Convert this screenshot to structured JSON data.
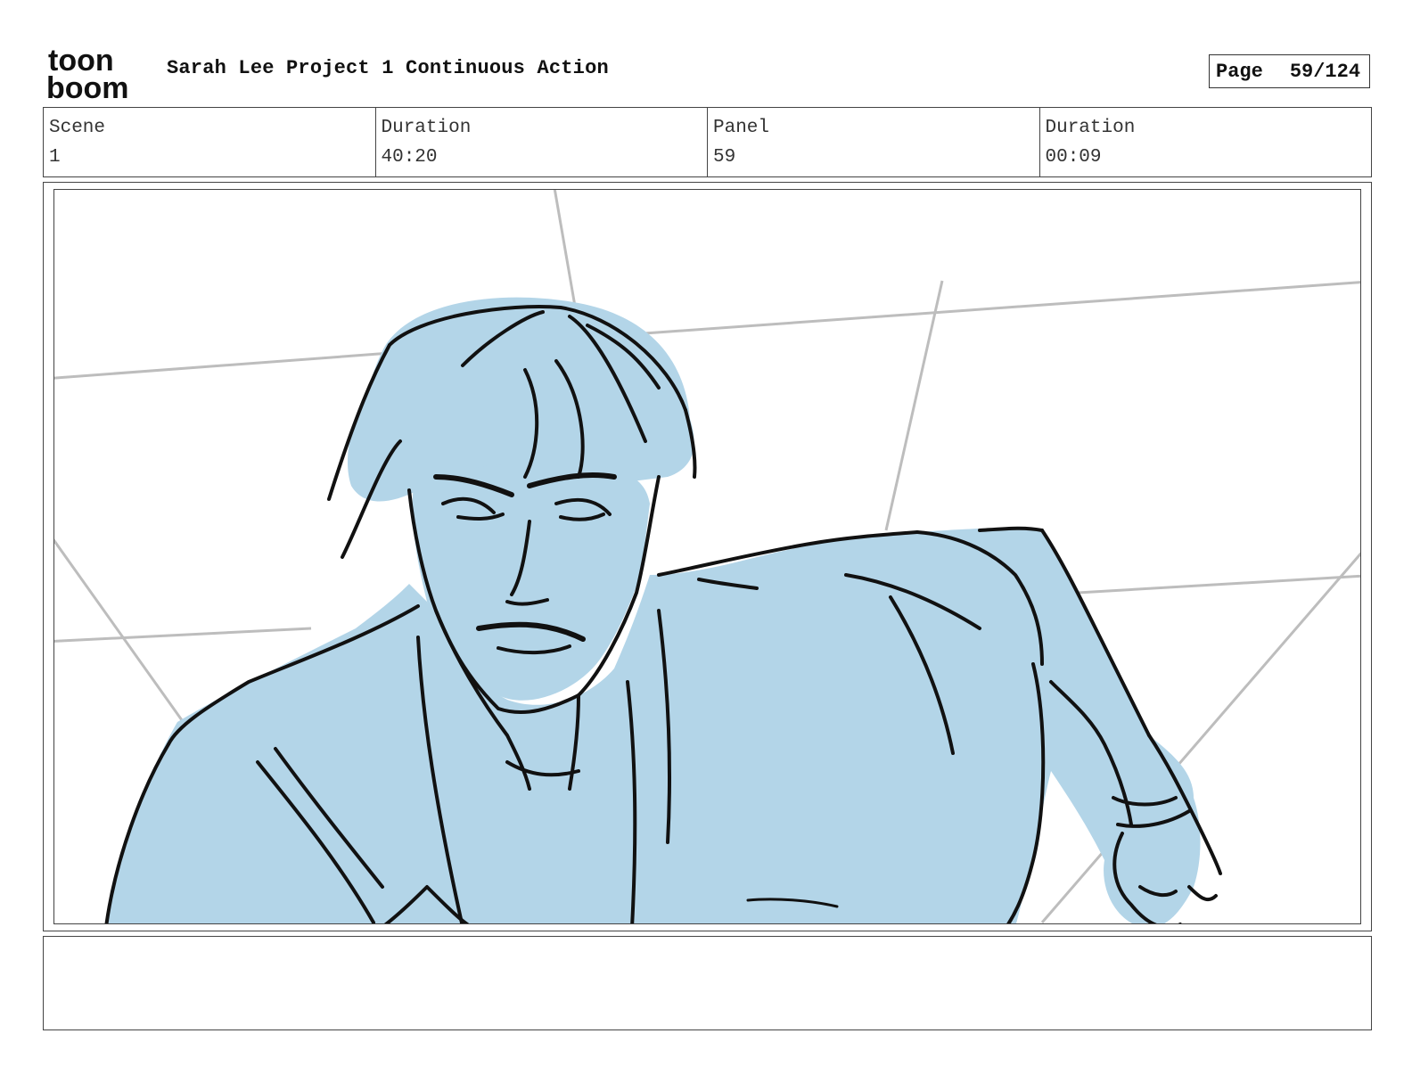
{
  "logo": {
    "text_line1": "toon",
    "text_line2": "boom"
  },
  "header": {
    "project_title": "Sarah Lee Project 1 Continuous Action",
    "page_label": "Page",
    "page_value": "59/124"
  },
  "info": {
    "scene_label": "Scene",
    "scene_value": "1",
    "duration_label": "Duration",
    "duration_value": "40:20",
    "panel_label": "Panel",
    "panel_value": "59",
    "panel_duration_label": "Duration",
    "panel_duration_value": "00:09"
  },
  "panel": {
    "fill_color": "#b3d5e8",
    "line_color": "#111111",
    "guide_color": "#bdbdbd"
  },
  "notes": {
    "text": ""
  }
}
